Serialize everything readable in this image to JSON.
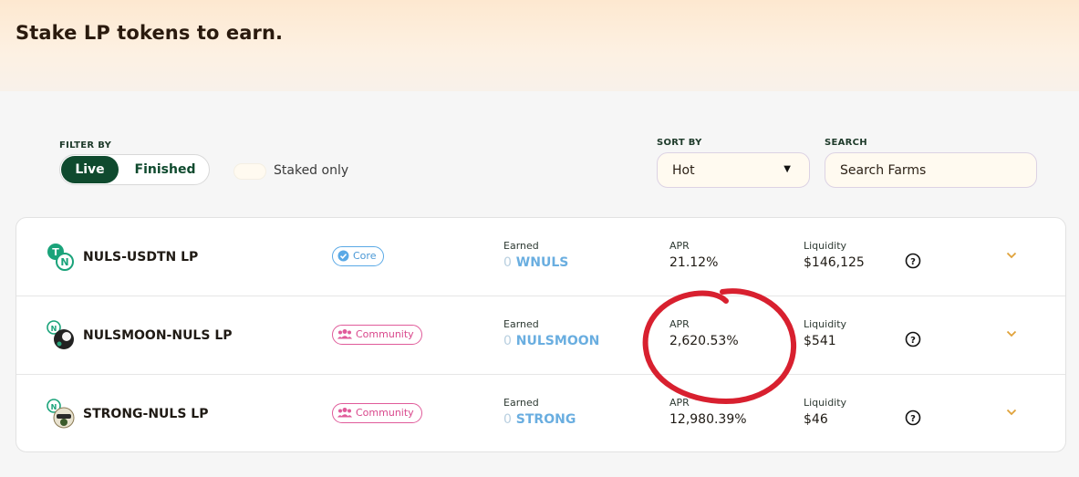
{
  "page": {
    "title": "Stake LP tokens to earn."
  },
  "filters": {
    "filter_by_label": "FILTER BY",
    "live_label": "Live",
    "finished_label": "Finished",
    "staked_only_label": "Staked only",
    "sort_by_label": "SORT BY",
    "sort_value": "Hot",
    "search_label": "SEARCH",
    "search_placeholder": "Search Farms"
  },
  "columns": {
    "earned": "Earned",
    "apr": "APR",
    "liquidity": "Liquidity"
  },
  "farms": [
    {
      "pair": "NULS-USDTN LP",
      "badge": "Core",
      "earned_amount": "0",
      "earned_token": "WNULS",
      "apr": "21.12%",
      "liquidity": "$146,125",
      "icon": "usdtn-nuls-icon"
    },
    {
      "pair": "NULSMOON-NULS LP",
      "badge": "Community",
      "earned_amount": "0",
      "earned_token": "NULSMOON",
      "apr": "2,620.53%",
      "liquidity": "$541",
      "icon": "nulsmoon-nuls-icon"
    },
    {
      "pair": "STRONG-NULS LP",
      "badge": "Community",
      "earned_amount": "0",
      "earned_token": "STRONG",
      "apr": "12,980.39%",
      "liquidity": "$46",
      "icon": "strong-nuls-icon"
    }
  ],
  "colors": {
    "primary_green": "#0f4a2e",
    "core_blue": "#5aa9e6",
    "community_pink": "#e05b9a",
    "annotation_red": "#d8202f"
  }
}
